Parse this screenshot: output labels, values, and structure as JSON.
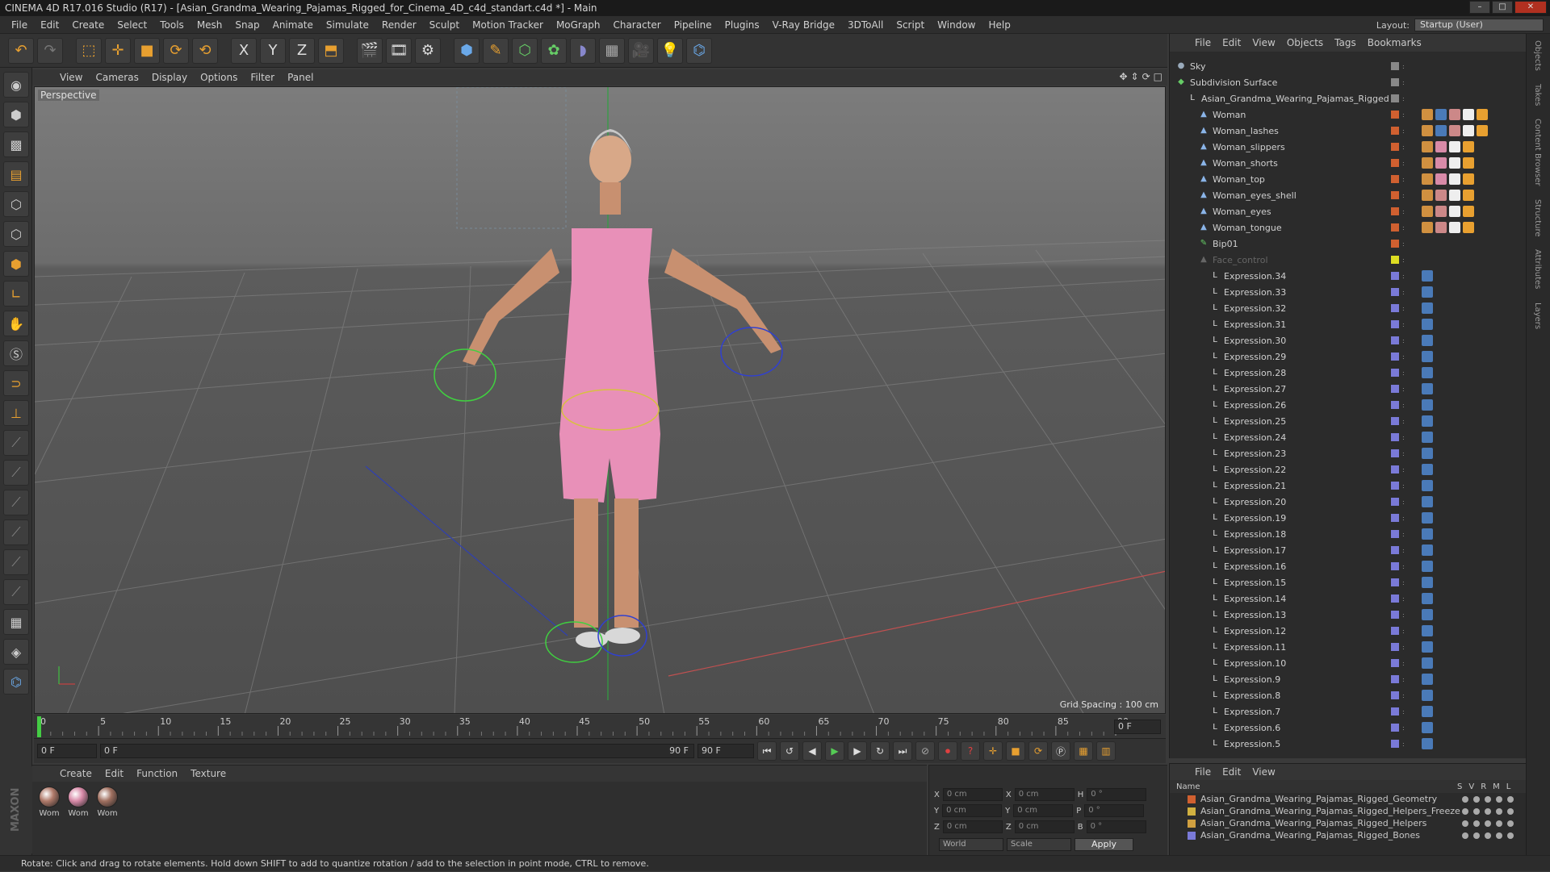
{
  "window": {
    "title": "CINEMA 4D R17.016 Studio (R17) - [Asian_Grandma_Wearing_Pajamas_Rigged_for_Cinema_4D_c4d_standart.c4d *] - Main"
  },
  "menu": [
    "File",
    "Edit",
    "Create",
    "Select",
    "Tools",
    "Mesh",
    "Snap",
    "Animate",
    "Simulate",
    "Render",
    "Sculpt",
    "Motion Tracker",
    "MoGraph",
    "Character",
    "Pipeline",
    "Plugins",
    "V-Ray Bridge",
    "3DToAll",
    "Script",
    "Window",
    "Help"
  ],
  "layout": {
    "label": "Layout:",
    "value": "Startup (User)"
  },
  "toolbar": {
    "x": "X",
    "y": "Y",
    "z": "Z"
  },
  "viewport": {
    "menu": [
      "View",
      "Cameras",
      "Display",
      "Options",
      "Filter",
      "Panel"
    ],
    "label": "Perspective",
    "grid_spacing": "Grid Spacing : 100 cm"
  },
  "timeline": {
    "ticks": [
      "0",
      "5",
      "10",
      "15",
      "20",
      "25",
      "30",
      "35",
      "40",
      "45",
      "50",
      "55",
      "60",
      "65",
      "70",
      "75",
      "80",
      "85",
      "90"
    ],
    "frame_end_display": "0 F"
  },
  "playbar": {
    "start": "0 F",
    "range_start": "0 F",
    "range_end": "90 F",
    "end": "90 F"
  },
  "materials": {
    "menu": [
      "Create",
      "Edit",
      "Function",
      "Texture"
    ],
    "items": [
      {
        "label": "Wom",
        "color": "#b07a6a"
      },
      {
        "label": "Wom",
        "color": "#d88aa8"
      },
      {
        "label": "Wom",
        "color": "#a07060"
      }
    ]
  },
  "coords": {
    "rows": [
      {
        "a": "X",
        "av": "0 cm",
        "b": "X",
        "bv": "0 cm",
        "c": "H",
        "cv": "0 °"
      },
      {
        "a": "Y",
        "av": "0 cm",
        "b": "Y",
        "bv": "0 cm",
        "c": "P",
        "cv": "0 °"
      },
      {
        "a": "Z",
        "av": "0 cm",
        "b": "Z",
        "bv": "0 cm",
        "c": "B",
        "cv": "0 °"
      }
    ],
    "world": "World",
    "scale": "Scale",
    "apply": "Apply"
  },
  "objects": {
    "menu": [
      "File",
      "Edit",
      "View",
      "Objects",
      "Tags",
      "Bookmarks"
    ],
    "rows": [
      {
        "name": "Sky",
        "indent": 0,
        "icon": "●",
        "color": "#9ab"
      },
      {
        "name": "Subdivision Surface",
        "indent": 0,
        "icon": "◆",
        "color": "#6c6"
      },
      {
        "name": "Asian_Grandma_Wearing_Pajamas_Rigged",
        "indent": 1,
        "icon": "L",
        "color": "#ddd"
      },
      {
        "name": "Woman",
        "indent": 2,
        "icon": "▲",
        "color": "#8ab4e8",
        "tags": [
          "#d09040",
          "#4a7ab8",
          "#c88",
          "#eee",
          "#e8a030"
        ]
      },
      {
        "name": "Woman_lashes",
        "indent": 2,
        "icon": "▲",
        "color": "#8ab4e8",
        "tags": [
          "#d09040",
          "#4a7ab8",
          "#c88",
          "#eee",
          "#e8a030"
        ]
      },
      {
        "name": "Woman_slippers",
        "indent": 2,
        "icon": "▲",
        "color": "#8ab4e8",
        "tags": [
          "#d09040",
          "#d88aa8",
          "#eee",
          "#e8a030"
        ]
      },
      {
        "name": "Woman_shorts",
        "indent": 2,
        "icon": "▲",
        "color": "#8ab4e8",
        "tags": [
          "#d09040",
          "#d88aa8",
          "#eee",
          "#e8a030"
        ]
      },
      {
        "name": "Woman_top",
        "indent": 2,
        "icon": "▲",
        "color": "#8ab4e8",
        "tags": [
          "#d09040",
          "#d88aa8",
          "#eee",
          "#e8a030"
        ]
      },
      {
        "name": "Woman_eyes_shell",
        "indent": 2,
        "icon": "▲",
        "color": "#8ab4e8",
        "tags": [
          "#d09040",
          "#c88",
          "#eee",
          "#e8a030"
        ]
      },
      {
        "name": "Woman_eyes",
        "indent": 2,
        "icon": "▲",
        "color": "#8ab4e8",
        "tags": [
          "#d09040",
          "#c88",
          "#eee",
          "#e8a030"
        ]
      },
      {
        "name": "Woman_tongue",
        "indent": 2,
        "icon": "▲",
        "color": "#8ab4e8",
        "tags": [
          "#d09040",
          "#c88",
          "#eee",
          "#e8a030"
        ]
      },
      {
        "name": "Bip01",
        "indent": 2,
        "icon": "✎",
        "color": "#6c6"
      },
      {
        "name": "Face_control",
        "indent": 2,
        "icon": "▲",
        "color": "#666",
        "dim": true
      },
      {
        "name": "Expression.34",
        "indent": 3
      },
      {
        "name": "Expression.33",
        "indent": 3
      },
      {
        "name": "Expression.32",
        "indent": 3
      },
      {
        "name": "Expression.31",
        "indent": 3
      },
      {
        "name": "Expression.30",
        "indent": 3
      },
      {
        "name": "Expression.29",
        "indent": 3
      },
      {
        "name": "Expression.28",
        "indent": 3
      },
      {
        "name": "Expression.27",
        "indent": 3
      },
      {
        "name": "Expression.26",
        "indent": 3
      },
      {
        "name": "Expression.25",
        "indent": 3
      },
      {
        "name": "Expression.24",
        "indent": 3
      },
      {
        "name": "Expression.23",
        "indent": 3
      },
      {
        "name": "Expression.22",
        "indent": 3
      },
      {
        "name": "Expression.21",
        "indent": 3
      },
      {
        "name": "Expression.20",
        "indent": 3
      },
      {
        "name": "Expression.19",
        "indent": 3
      },
      {
        "name": "Expression.18",
        "indent": 3
      },
      {
        "name": "Expression.17",
        "indent": 3
      },
      {
        "name": "Expression.16",
        "indent": 3
      },
      {
        "name": "Expression.15",
        "indent": 3
      },
      {
        "name": "Expression.14",
        "indent": 3
      },
      {
        "name": "Expression.13",
        "indent": 3
      },
      {
        "name": "Expression.12",
        "indent": 3
      },
      {
        "name": "Expression.11",
        "indent": 3
      },
      {
        "name": "Expression.10",
        "indent": 3
      },
      {
        "name": "Expression.9",
        "indent": 3
      },
      {
        "name": "Expression.8",
        "indent": 3
      },
      {
        "name": "Expression.7",
        "indent": 3
      },
      {
        "name": "Expression.6",
        "indent": 3
      },
      {
        "name": "Expression.5",
        "indent": 3
      }
    ]
  },
  "layers": {
    "menu": [
      "File",
      "Edit",
      "View"
    ],
    "header": "Name",
    "cols": [
      "S",
      "V",
      "R",
      "M",
      "L"
    ],
    "rows": [
      {
        "name": "Asian_Grandma_Wearing_Pajamas_Rigged_Geometry",
        "color": "#d06030"
      },
      {
        "name": "Asian_Grandma_Wearing_Pajamas_Rigged_Helpers_Freeze",
        "color": "#d0b040"
      },
      {
        "name": "Asian_Grandma_Wearing_Pajamas_Rigged_Helpers",
        "color": "#d0a040"
      },
      {
        "name": "Asian_Grandma_Wearing_Pajamas_Rigged_Bones",
        "color": "#7a7ad8"
      }
    ]
  },
  "sidetabs": [
    "Objects",
    "Takes",
    "Content Browser",
    "Structure",
    "Attributes",
    "Layers"
  ],
  "status": "Rotate: Click and drag to rotate elements. Hold down SHIFT to add to quantize rotation / add to the selection in point mode, CTRL to remove.",
  "brand": "MAXON CINEMA 4D"
}
